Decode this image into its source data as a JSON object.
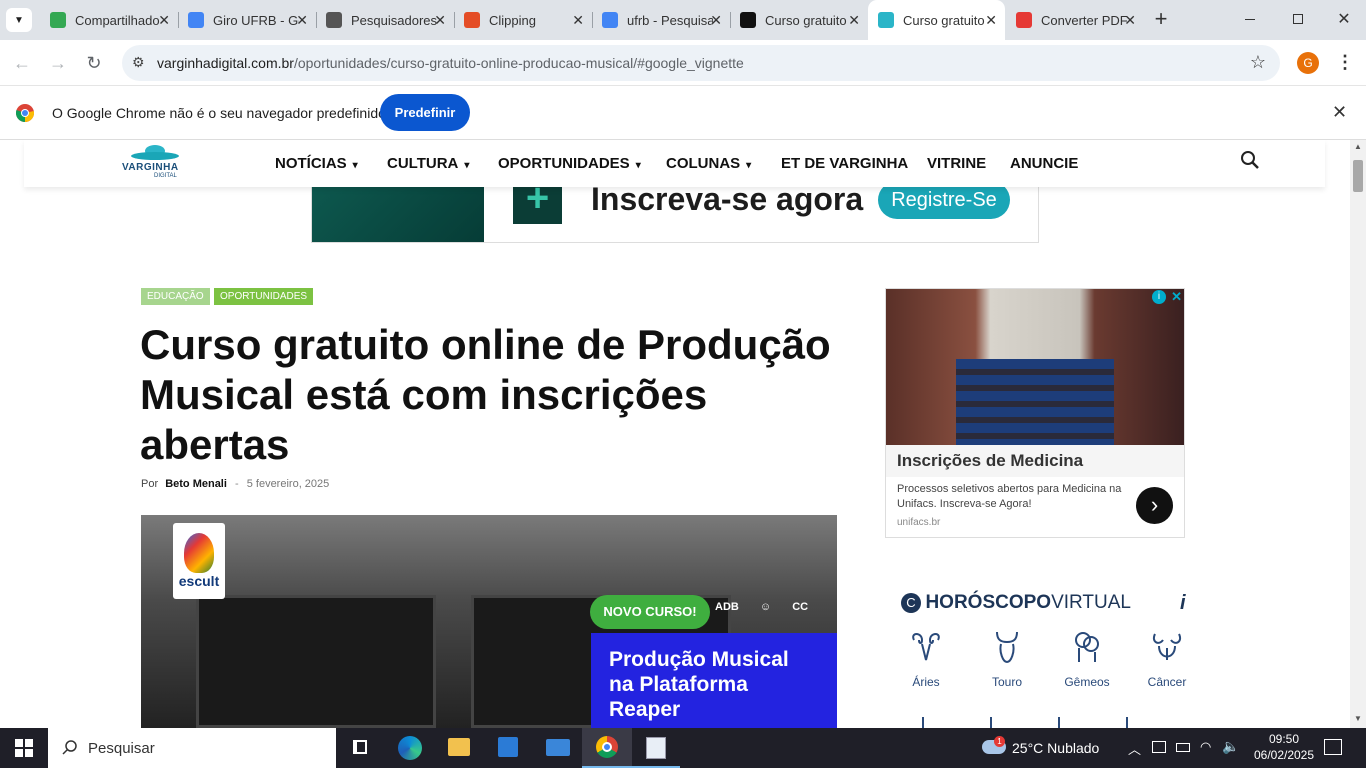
{
  "tabs": [
    {
      "title": "Compartilhado",
      "color": "#34a853",
      "active": false
    },
    {
      "title": "Giro UFRB - Google Docs",
      "color": "#4285f4",
      "active": false
    },
    {
      "title": "Pesquisadores",
      "color": "#555",
      "active": false
    },
    {
      "title": "Clipping",
      "color": "#e44d26",
      "active": false
    },
    {
      "title": "ufrb - Pesquisa Google",
      "color": "#4285f4",
      "active": false
    },
    {
      "title": "Curso gratuito",
      "color": "#111",
      "active": false
    },
    {
      "title": "Curso gratuito",
      "color": "#2bb5c8",
      "active": true
    },
    {
      "title": "Converter PDF",
      "color": "#e53935",
      "active": false
    }
  ],
  "browser": {
    "url_host": "varginhadigital.com.br",
    "url_path": "/oportunidades/curso-gratuito-online-producao-musical/#google_vignette",
    "profile_initial": "G"
  },
  "infobar": {
    "message": "O Google Chrome não é o seu navegador predefinido.",
    "button": "Predefinir"
  },
  "site": {
    "logo_text": "VARGINHA",
    "logo_sub": "DIGITAL",
    "menu": [
      {
        "label": "NOTÍCIAS",
        "dropdown": true
      },
      {
        "label": "CULTURA",
        "dropdown": true
      },
      {
        "label": "OPORTUNIDADES",
        "dropdown": true
      },
      {
        "label": "COLUNAS",
        "dropdown": true
      },
      {
        "label": "ET DE VARGINHA",
        "dropdown": false
      },
      {
        "label": "VITRINE",
        "dropdown": false
      },
      {
        "label": "ANUNCIE",
        "dropdown": false
      }
    ]
  },
  "ad_banner": {
    "headline": "Inscreva-se agora",
    "cta": "Registre-Se"
  },
  "article": {
    "categories": [
      "EDUCAÇÃO",
      "OPORTUNIDADES"
    ],
    "category_colors": [
      "#a7d58e",
      "#7cc242"
    ],
    "title": "Curso gratuito online de Produção Musical está com inscrições abertas",
    "by": "Por",
    "author": "Beto Menali",
    "dash": "-",
    "date": "5 fevereiro, 2025",
    "hero": {
      "brand": "escult",
      "badge": "NOVO CURSO!",
      "tags": [
        "ADB",
        "☺",
        "CC"
      ],
      "text": "Produção Musical na Plataforma Reaper"
    }
  },
  "side_ad": {
    "title": "Inscrições de Medicina",
    "body": "Processos seletivos abertos para Medicina na Unifacs. Inscreva-se Agora!",
    "domain": "unifacs.br"
  },
  "horoscope": {
    "brand_bold": "HORÓSCOPO",
    "brand_light": "VIRTUAL",
    "info": "i",
    "signs": [
      "Áries",
      "Touro",
      "Gêmeos",
      "Câncer"
    ]
  },
  "taskbar": {
    "search_placeholder": "Pesquisar",
    "weather": "25°C  Nublado",
    "weather_badge": "1",
    "time": "09:50",
    "date": "06/02/2025"
  }
}
